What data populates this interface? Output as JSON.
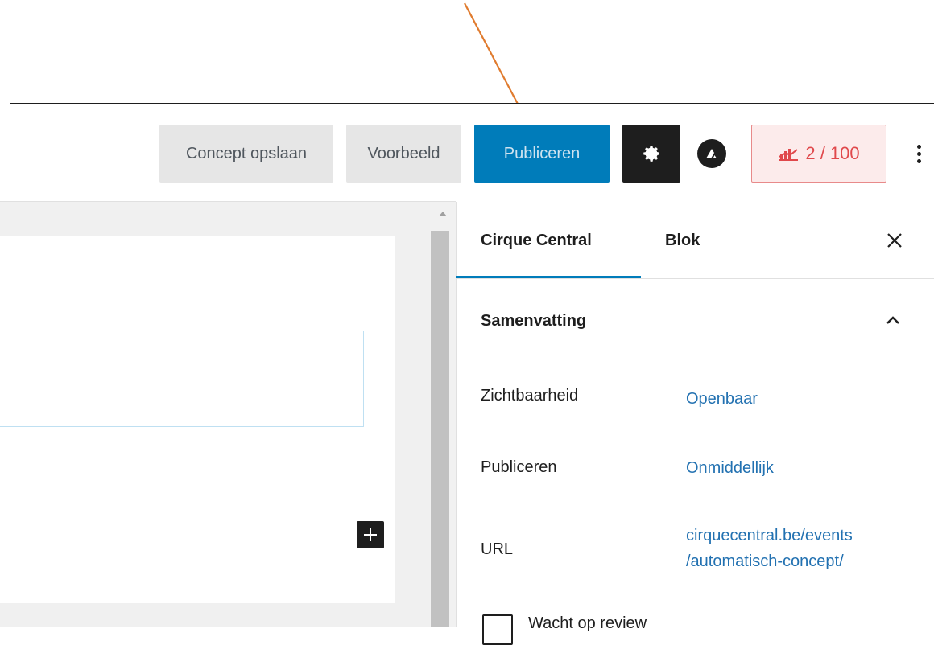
{
  "toolbar": {
    "save_draft": "Concept opslaan",
    "preview": "Voorbeeld",
    "publish": "Publiceren",
    "score": "2 / 100"
  },
  "sidebar": {
    "tabs": [
      {
        "label": "Cirque Central"
      },
      {
        "label": "Blok"
      }
    ],
    "section": {
      "title": "Samenvatting",
      "rows": [
        {
          "label": "Zichtbaarheid",
          "value": "Openbaar"
        },
        {
          "label": "Publiceren",
          "value": "Onmiddellijk"
        },
        {
          "label": "URL",
          "value_line1": "cirquecentral.be/events",
          "value_line2": "/automatisch-concept/"
        }
      ],
      "cut_off_text": "Wacht op review"
    }
  },
  "colors": {
    "primary": "#007cba",
    "link": "#2271b1",
    "score_red": "#e0484b",
    "annotation_arrow": "#e07b2e"
  },
  "icons": {
    "settings": "gear-icon",
    "astra": "astra-logo-icon",
    "score": "seo-chart-icon",
    "more": "more-vertical-icon",
    "close": "close-icon",
    "collapse": "chevron-up-icon",
    "add_block": "plus-icon"
  }
}
